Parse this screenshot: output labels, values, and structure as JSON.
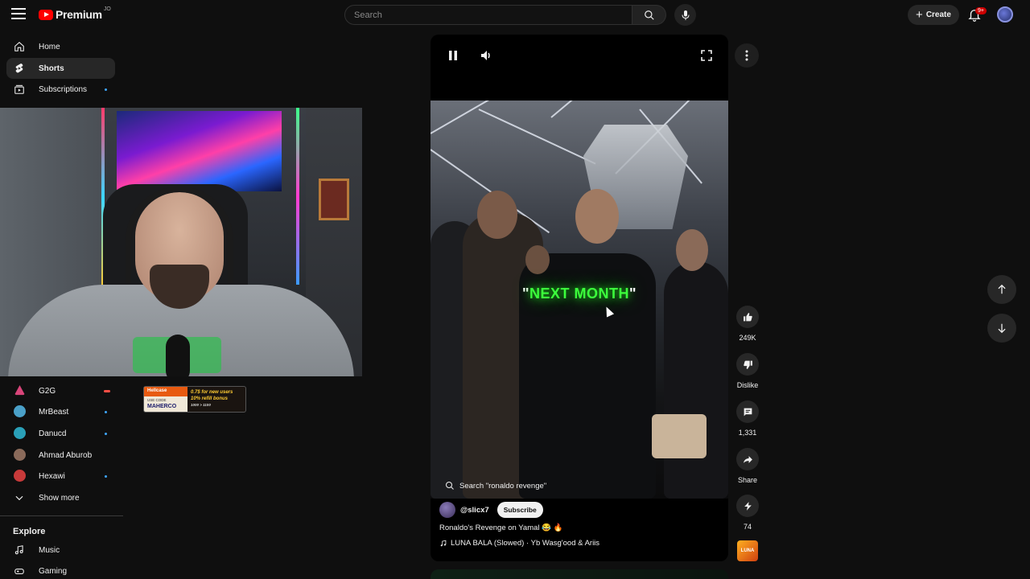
{
  "header": {
    "logo_text": "Premium",
    "country_code": "JO",
    "search_placeholder": "Search",
    "create_label": "Create",
    "notifications_badge": "9+"
  },
  "sidebar": {
    "items": [
      {
        "label": "Home"
      },
      {
        "label": "Shorts",
        "active": true
      },
      {
        "label": "Subscriptions"
      }
    ],
    "subscriptions": [
      {
        "name": "G2G",
        "color": "#d9457a"
      },
      {
        "name": "MrBeast",
        "color": "#4aa0c8"
      },
      {
        "name": "Danucd",
        "color": "#2aa0b8"
      },
      {
        "name": "Ahmad Aburob",
        "color": "#8a6a5a"
      },
      {
        "name": "Hexawi",
        "color": "#c83a3a"
      }
    ],
    "show_more": "Show more",
    "explore_title": "Explore",
    "explore_items": [
      {
        "label": "Music"
      },
      {
        "label": "Gaming"
      }
    ]
  },
  "overlay": {
    "brand": "Hellcase",
    "use_code_label": "USE CODE",
    "code": "MAHERCO",
    "offer_line1": "0.7$ for new users",
    "offer_line2": "10% refill bonus",
    "offer_line3": "1000 > 1100"
  },
  "short": {
    "caption": "NEXT MONTH",
    "search_suggestion": "Search \"ronaldo revenge\"",
    "channel": "@slicx7",
    "subscribe_label": "Subscribe",
    "title": "Ronaldo's Revenge on Yamal 😂 🔥",
    "music": "LUNA BALA (Slowed) · Yb Wasg'ood & Ariis"
  },
  "actions": {
    "likes": "249K",
    "dislike_label": "Dislike",
    "comments": "1,331",
    "share_label": "Share",
    "remix_count": "74",
    "sound_thumb_label": "LUNA"
  },
  "colors": {
    "accent_red": "#ff0000",
    "caption_green": "#3cff3c",
    "badge_red": "#cc0000",
    "unread_dot": "#3ea6ff"
  }
}
